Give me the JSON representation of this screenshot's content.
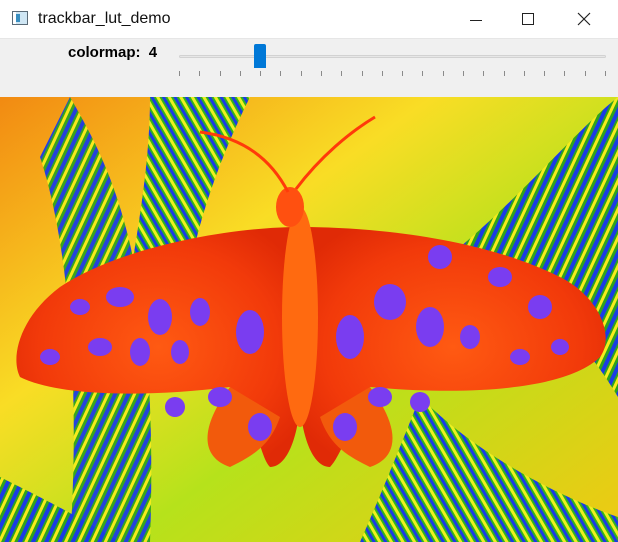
{
  "window": {
    "title": "trackbar_lut_demo"
  },
  "trackbar": {
    "name": "colormap: ",
    "value": "4",
    "min": 0,
    "max": 21,
    "position": 4
  },
  "image": {
    "description_icon": "colormapped-butterfly-image"
  },
  "icons": {
    "app": "window-app-icon",
    "minimize": "minimize-icon",
    "maximize": "maximize-icon",
    "close": "close-icon"
  },
  "colors": {
    "thumb": "#0078d7",
    "titlebar": "#ffffff",
    "panel": "#f0f0f0"
  }
}
